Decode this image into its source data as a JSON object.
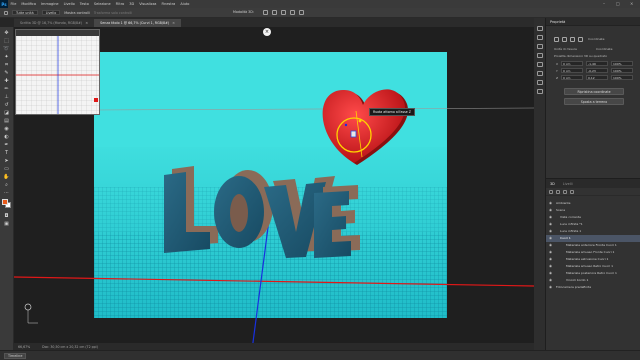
{
  "menu": {
    "logo": "Ps",
    "items": [
      "File",
      "Modifica",
      "Immagine",
      "Livello",
      "Testo",
      "Selezione",
      "Filtro",
      "3D",
      "Visualizza",
      "Finestra",
      "Aiuto"
    ]
  },
  "options": {
    "item1": "Tutte unità",
    "item2": "Livello",
    "item3": "Mostra controlli",
    "mode_label": "Modalità 3D:",
    "dim": "Trasforma solo controlli"
  },
  "tabs": [
    {
      "label": "Scritta 3D @ 16,7% (Mondo, RGB/8#)",
      "close": "×"
    },
    {
      "label": "Senza titolo 1 @ 66,7% (Curvi 1, RGB/8#)",
      "close": "×"
    }
  ],
  "canvas": {
    "love_text": "LOVE",
    "tooltip": "Ruota attorno all'asse Z",
    "close_glyph": "×"
  },
  "properties": {
    "title": "Proprietà",
    "mode": "Coordinate",
    "section": "Unità di misura",
    "section2": "Coordinate",
    "subtitle": "Proietta dimensioni 3D su quadrato",
    "pos_x_label": "X",
    "pos_x": "0 cm",
    "pos_y_label": "Y",
    "pos_y": "0 cm",
    "pos_z_label": "Z",
    "pos_z": "0 cm",
    "rot_x": "-1,49",
    "rot_y": "-0,23",
    "rot_z": "0,12",
    "scale_x": "100%",
    "scale_y": "100%",
    "scale_z": "100%",
    "btn1": "Ripristina coordinate",
    "btn2": "Sposta a terreno"
  },
  "layers": {
    "tab1": "3D",
    "tab2": "Livelli",
    "items": [
      "Ambiente",
      "Scena",
      "Vista corrente",
      "Luce infinita *1",
      "Luce infinita 1",
      "Cuori 1",
      "Materiale anteriore Fronte Cuori 1",
      "Materiale smusso Fronte Cuori 1",
      "Materiale estrusione Cuori 1",
      "Materiale smusso Retro Cuori 1",
      "Materiale posteriore Retro Cuori 1",
      "Vincoli bordo 1",
      "Fotocamera predefinita"
    ]
  },
  "status": {
    "zoom": "66,67%",
    "doc": "Doc: 30,50 cm x 20,32 cm (72 ppi)"
  },
  "timeline": {
    "label": "Timeline"
  },
  "colors": {
    "sky": "#40e0e0",
    "floor": "#2bd6d6",
    "heart": "#e0191c",
    "accent": "#31a8ff"
  }
}
